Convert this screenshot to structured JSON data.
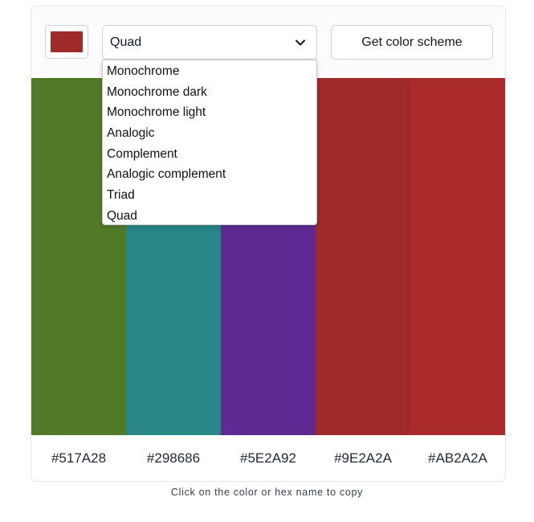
{
  "seed_color": "#9E2A2A",
  "scheme_select": {
    "value": "Quad",
    "options": [
      "Monochrome",
      "Monochrome dark",
      "Monochrome light",
      "Analogic",
      "Complement",
      "Analogic complement",
      "Triad",
      "Quad"
    ]
  },
  "button_label": "Get color scheme",
  "colors": [
    {
      "hex": "#517A28"
    },
    {
      "hex": "#298686"
    },
    {
      "hex": "#5E2A92"
    },
    {
      "hex": "#9E2A2A"
    },
    {
      "hex": "#AB2A2A"
    }
  ],
  "hint": "Click on the color or hex name to copy",
  "icons": {
    "select_arrow": "chevron-down-icon"
  }
}
